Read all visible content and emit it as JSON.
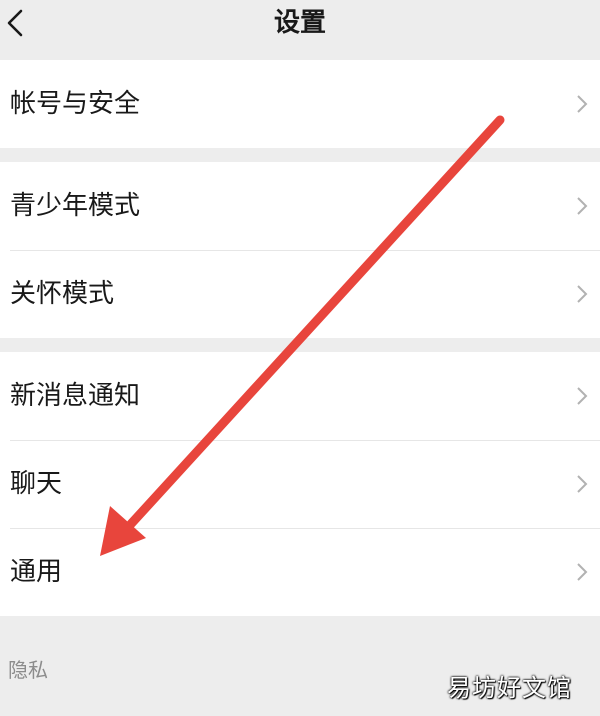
{
  "nav": {
    "title": "设置",
    "back_icon": "chevron-left-icon"
  },
  "groups": [
    {
      "items": [
        {
          "label": "帐号与安全"
        }
      ]
    },
    {
      "items": [
        {
          "label": "青少年模式"
        },
        {
          "label": "关怀模式"
        }
      ]
    },
    {
      "items": [
        {
          "label": "新消息通知"
        },
        {
          "label": "聊天"
        },
        {
          "label": "通用"
        }
      ]
    }
  ],
  "section": {
    "label": "隐私"
  },
  "watermark": "易坊好文馆",
  "colors": {
    "background": "#ededed",
    "card": "#ffffff",
    "arrow": "#e8453c",
    "chevron": "#b2b2b2"
  }
}
